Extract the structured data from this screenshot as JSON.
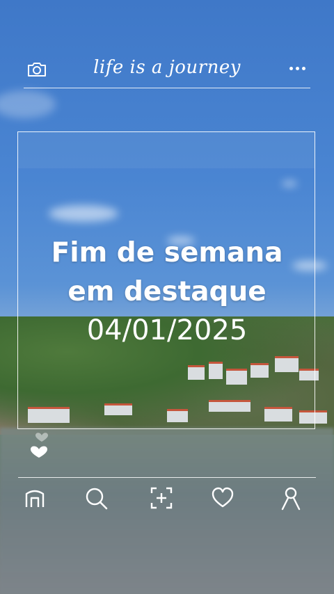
{
  "header": {
    "title": "life is a journey",
    "camera_icon": "camera-icon",
    "more_icon": "more-dots-icon"
  },
  "post": {
    "headline_line1": "Fim de semana",
    "headline_line2": "em destaque",
    "date": "04/01/2025"
  },
  "reactions": {
    "icon": "heart-icon"
  },
  "nav": {
    "items": [
      {
        "name": "home",
        "icon": "home-icon"
      },
      {
        "name": "search",
        "icon": "search-icon"
      },
      {
        "name": "add",
        "icon": "add-post-icon"
      },
      {
        "name": "likes",
        "icon": "heart-outline-icon"
      },
      {
        "name": "profile",
        "icon": "profile-icon"
      }
    ]
  },
  "colors": {
    "sky": "#4a85d2",
    "foreground": "#ffffff"
  }
}
